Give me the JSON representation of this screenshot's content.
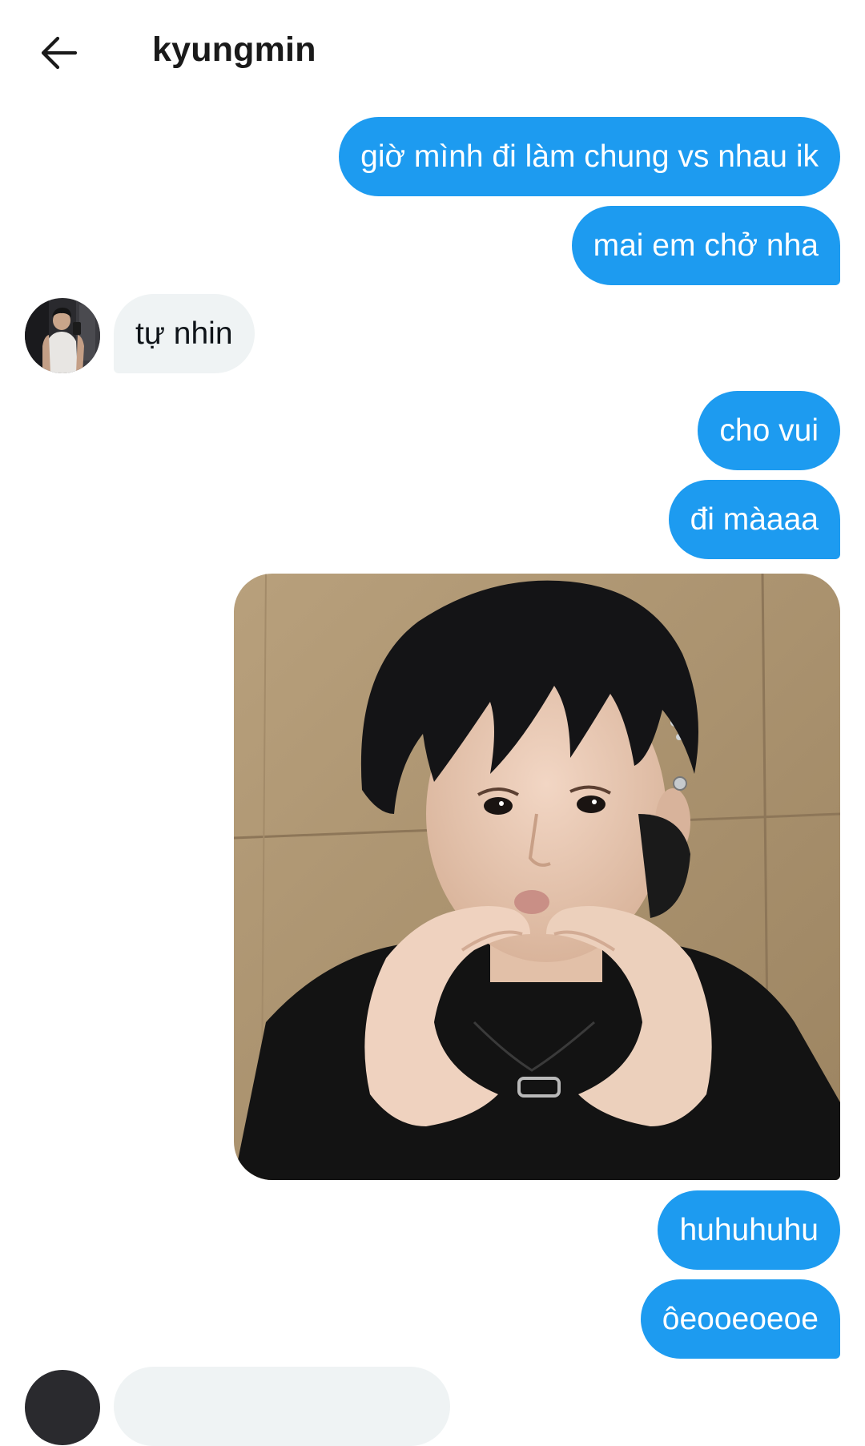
{
  "header": {
    "title": "kyungmin",
    "back_icon": "arrow-left-icon"
  },
  "messages": [
    {
      "id": "m1",
      "direction": "outgoing",
      "text": "giờ mình đi làm chung vs nhau ik"
    },
    {
      "id": "m2",
      "direction": "outgoing",
      "text": "mai em chở nha"
    },
    {
      "id": "m3",
      "direction": "incoming",
      "text": "tự nhin"
    },
    {
      "id": "m4",
      "direction": "outgoing",
      "text": "cho vui"
    },
    {
      "id": "m5",
      "direction": "outgoing",
      "text": "đi màaaa"
    },
    {
      "id": "m6",
      "direction": "outgoing",
      "type": "image"
    },
    {
      "id": "m7",
      "direction": "outgoing",
      "text": "huhuhuhu"
    },
    {
      "id": "m8",
      "direction": "outgoing",
      "text": "ôeooeoeoe"
    },
    {
      "id": "m9",
      "direction": "incoming",
      "text": ""
    }
  ],
  "colors": {
    "outgoing_bubble": "#1d9bf0",
    "incoming_bubble": "#eff3f4",
    "background": "#ffffff",
    "title": "#1a1a1a"
  }
}
